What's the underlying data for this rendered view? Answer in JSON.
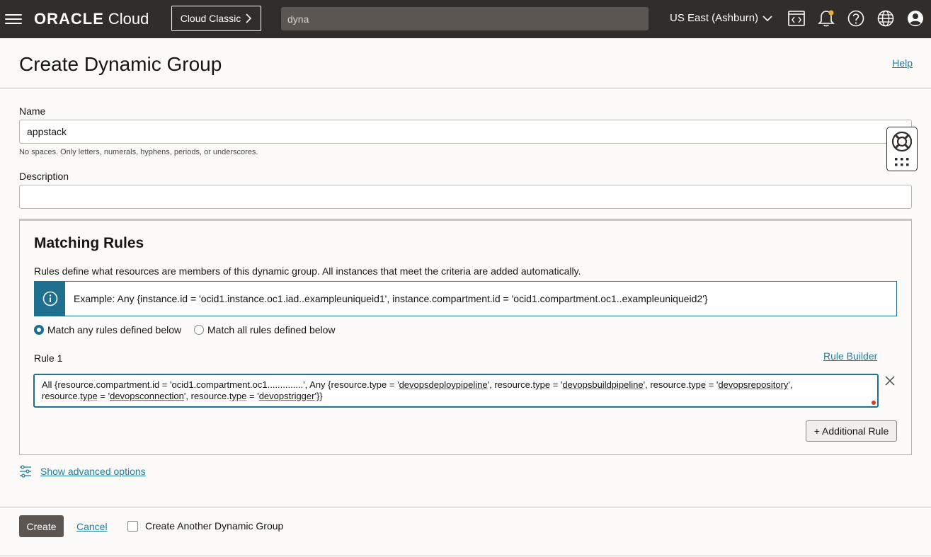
{
  "topbar": {
    "logo_text": "ORACLE",
    "logo_cloud": "Cloud",
    "classic_button": "Cloud Classic",
    "search_value": "dyna",
    "region": "US East (Ashburn)",
    "icons": [
      "hamburger-menu-icon",
      "code-editor-icon",
      "notification-bell-icon",
      "help-question-icon",
      "language-globe-icon",
      "user-profile-icon"
    ]
  },
  "header": {
    "title": "Create Dynamic Group",
    "help_link": "Help"
  },
  "form": {
    "name_label": "Name",
    "name_value": "appstack",
    "name_hint": "No spaces. Only letters, numerals, hyphens, periods, or underscores.",
    "description_label": "Description",
    "description_value": ""
  },
  "rules": {
    "title": "Matching Rules",
    "description": "Rules define what resources are members of this dynamic group. All instances that meet the criteria are added automatically.",
    "example": "Example: Any {instance.id = 'ocid1.instance.oc1.iad..exampleuniqueid1', instance.compartment.id = 'ocid1.compartment.oc1..exampleuniqueid2'}",
    "match_any_label": "Match any rules defined below",
    "match_all_label": "Match all rules defined below",
    "match_selected": "any",
    "rule1_label": "Rule 1",
    "rule_builder_link": "Rule Builder",
    "rule1_line1": {
      "a": "All {resource.compartment.id = 'ocid1.compartment.oc1..............', Any {resource.type = '",
      "b": "devopsdeploypipeline",
      "c": "', resource.",
      "d": "type",
      "e": " = '",
      "f": "devopsbuildpipeline",
      "g": "', resource.",
      "h": "type",
      "i": " = '",
      "j": "devopsrepository",
      "k": "',"
    },
    "rule1_line2": {
      "a": "resource.",
      "b": "type",
      "c": " = '",
      "d": "devopsconnection",
      "e": "', resource.",
      "f": "type",
      "g": " = '",
      "h": "devopstrigger",
      "i": "'}}"
    },
    "add_rule_button": "+ Additional Rule"
  },
  "advanced": {
    "link": "Show advanced options"
  },
  "footer": {
    "create_button": "Create",
    "cancel_link": "Cancel",
    "create_another_label": "Create Another Dynamic Group",
    "create_another_checked": false
  },
  "colors": {
    "topbar_bg": "#312d2a",
    "accent": "#227e9e",
    "info_bg": "#1f6f8f",
    "primary_button": "#5b5652"
  }
}
